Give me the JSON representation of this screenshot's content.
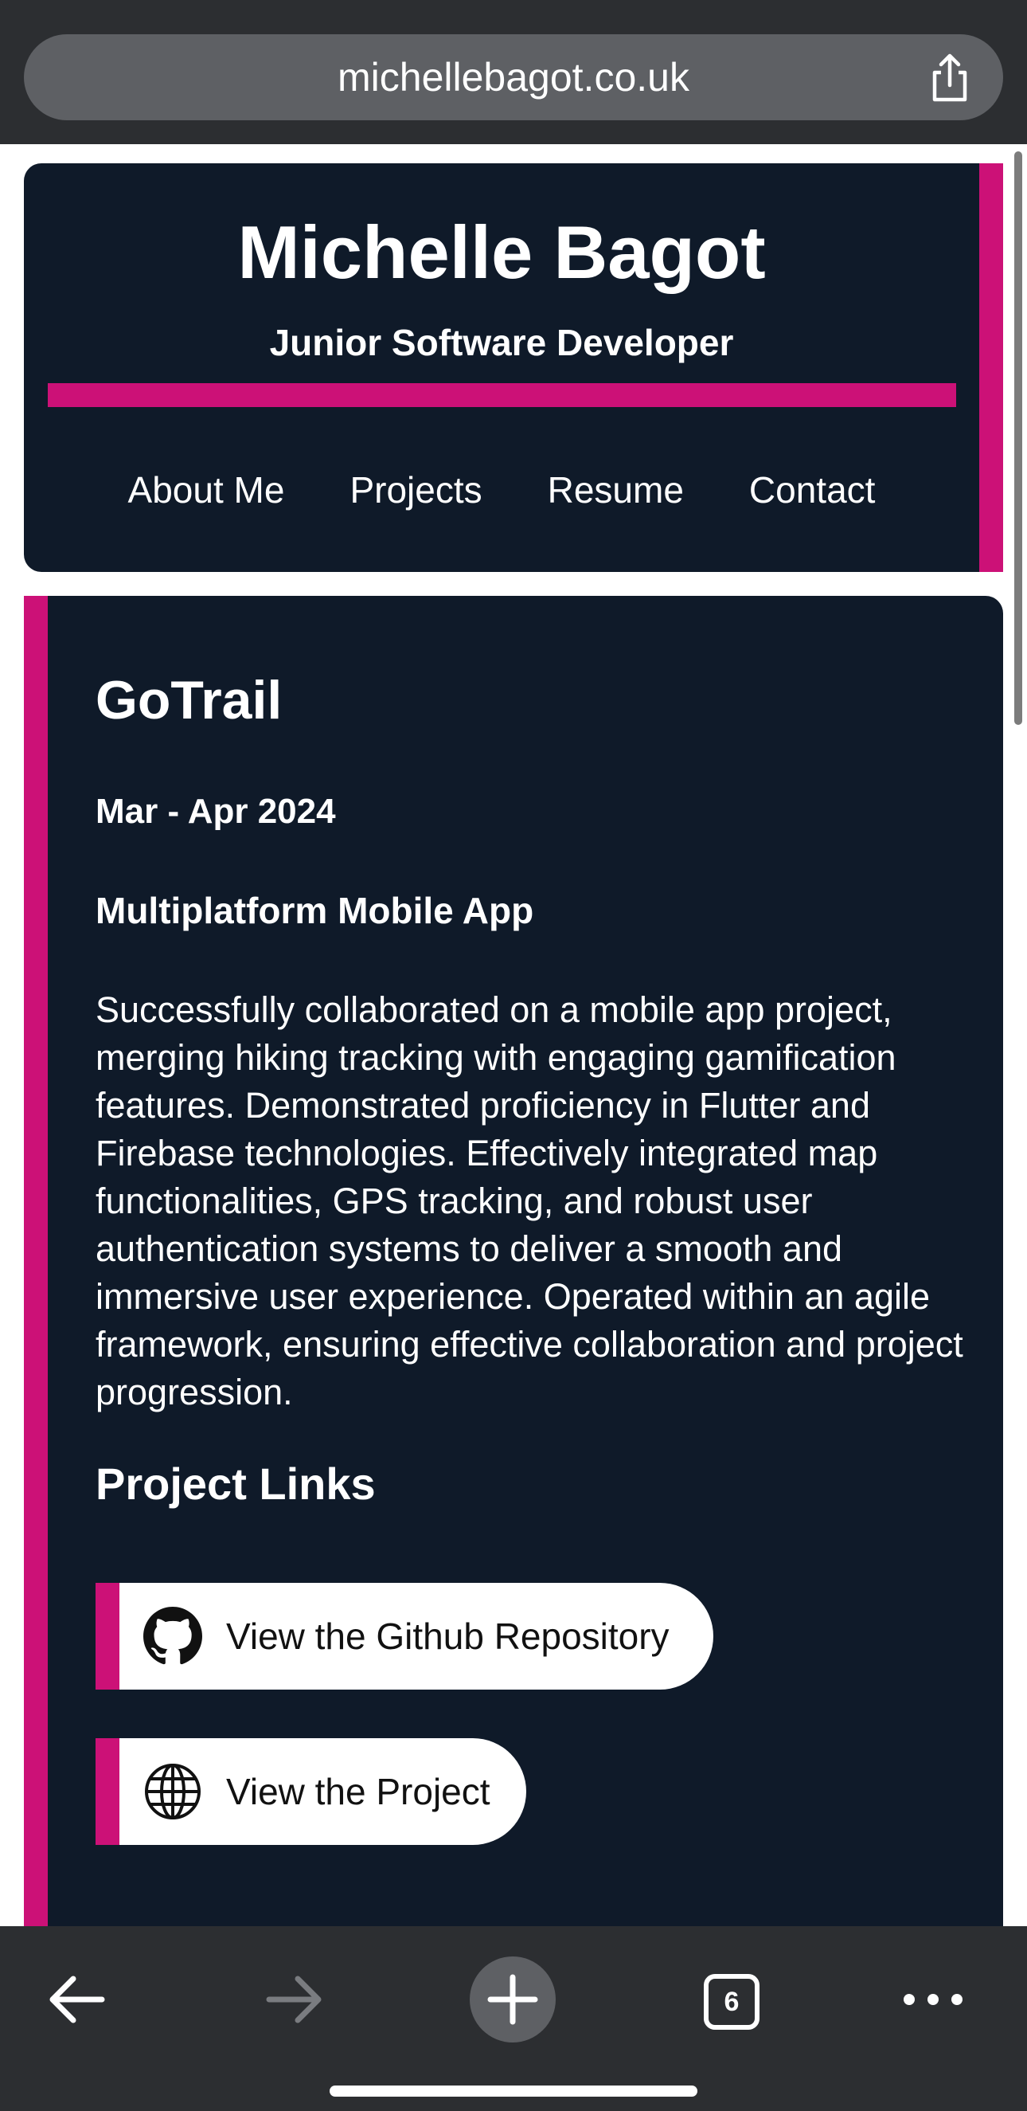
{
  "browser": {
    "url": "michellebagot.co.uk",
    "tab_count": "6"
  },
  "header": {
    "title": "Michelle Bagot",
    "subtitle": "Junior Software Developer",
    "nav": [
      "About Me",
      "Projects",
      "Resume",
      "Contact"
    ]
  },
  "project": {
    "title": "GoTrail",
    "date": "Mar - Apr 2024",
    "type": "Multiplatform Mobile App",
    "description": "Successfully collaborated on a mobile app project, merging hiking tracking with engaging gamification features. Demonstrated proficiency in Flutter and Firebase technologies. Effectively integrated map functionalities, GPS tracking, and robust user authentication systems to deliver a smooth and immersive user experience. Operated within an agile framework, ensuring effective collaboration and project progression.",
    "links_heading": "Project Links",
    "links": [
      {
        "label": "View the Github Repository",
        "icon": "github-icon"
      },
      {
        "label": "View the Project",
        "icon": "globe-icon"
      }
    ]
  },
  "colors": {
    "card_background": "#0f1a29",
    "accent": "#cc1177",
    "browser_chrome": "#2c2e31"
  },
  "icons": [
    "share-icon",
    "back-arrow-icon",
    "forward-arrow-icon",
    "plus-icon",
    "tabs-icon",
    "more-dots-icon"
  ]
}
